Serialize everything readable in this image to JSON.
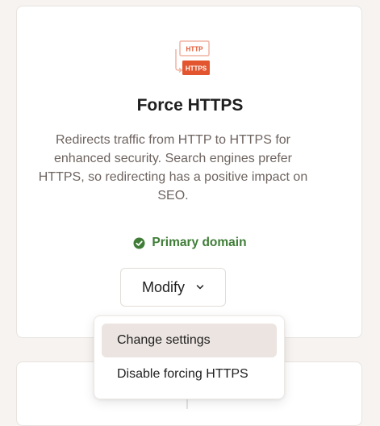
{
  "feature": {
    "title": "Force HTTPS",
    "description": "Redirects traffic from HTTP to HTTPS for enhanced security. Search engines prefer HTTPS, so redirecting has a positive impact on SEO.",
    "illustration": {
      "top_label": "HTTP",
      "bottom_label": "HTTPS"
    }
  },
  "status": {
    "label": "Primary domain",
    "icon": "check-circle-icon",
    "color": "#3f7d37"
  },
  "modify_button": {
    "label": "Modify",
    "icon": "chevron-down-icon"
  },
  "dropdown_menu": {
    "items": [
      {
        "label": "Change settings",
        "highlighted": true
      },
      {
        "label": "Disable forcing HTTPS",
        "highlighted": false
      }
    ]
  },
  "colors": {
    "accent": "#e3552f",
    "page_background": "#f6f3f0",
    "card_background": "#ffffff",
    "text_primary": "#1f1f1f",
    "text_secondary": "#6e6460",
    "menu_highlight": "#ebe4e1"
  }
}
